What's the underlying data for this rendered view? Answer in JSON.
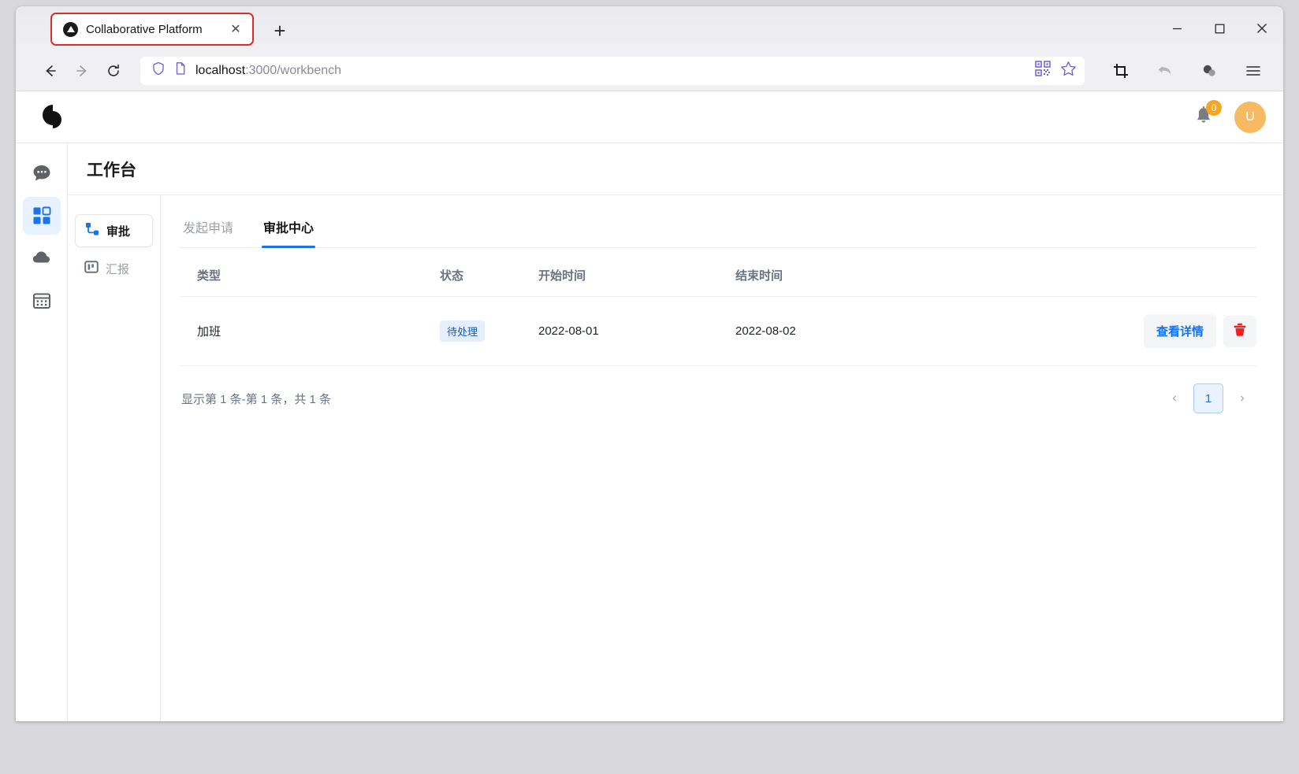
{
  "browser": {
    "tab": {
      "title": "Collaborative Platform",
      "favicon": "triangle-favicon",
      "close_label": "✕"
    },
    "new_tab_label": "+",
    "window_controls": {
      "minimize": "—",
      "maximize": "▢",
      "close": "✕"
    },
    "nav": {
      "back": "←",
      "forward": "→",
      "reload": "⟳"
    },
    "url": {
      "host": "localhost",
      "rest": ":3000/workbench"
    },
    "urlbar_icons": [
      "shield-icon",
      "page-icon",
      "qr-code-icon",
      "bookmark-star-icon"
    ],
    "toolbar_icons": [
      "crop-icon",
      "undo-icon",
      "extension-icon",
      "menu-icon"
    ]
  },
  "app": {
    "logo_name": "collaborative-platform-logo",
    "notifications": {
      "icon": "bell-icon",
      "count": "0"
    },
    "avatar": {
      "initial": "U"
    },
    "rail": [
      {
        "name": "sidebar-item-chat",
        "icon": "chat-bubble-icon",
        "active": false
      },
      {
        "name": "sidebar-item-workbench",
        "icon": "apps-grid-icon",
        "active": true
      },
      {
        "name": "sidebar-item-cloud",
        "icon": "cloud-icon",
        "active": false
      },
      {
        "name": "sidebar-item-calendar",
        "icon": "calendar-grid-icon",
        "active": false
      }
    ],
    "page_title": "工作台",
    "submenu": [
      {
        "label": "审批",
        "icon": "approval-icon",
        "active": true
      },
      {
        "label": "汇报",
        "icon": "report-icon",
        "active": false
      }
    ],
    "tabs": [
      {
        "label": "发起申请",
        "active": false
      },
      {
        "label": "审批中心",
        "active": true
      }
    ],
    "table": {
      "columns": [
        "类型",
        "状态",
        "开始时间",
        "结束时间",
        ""
      ],
      "rows": [
        {
          "type": "加班",
          "status": "待处理",
          "start_time": "2022-08-01",
          "end_time": "2022-08-02",
          "detail_label": "查看详情",
          "delete_icon": "trash-icon"
        }
      ]
    },
    "footer": {
      "summary": "显示第 1 条-第 1 条，共 1 条",
      "prev_label": "‹",
      "next_label": "›",
      "current_page": "1"
    },
    "colors": {
      "accent": "#1a73e8",
      "badge_bg": "#e4eefc",
      "badge_text": "#1558c0",
      "avatar_bg": "#f8b963",
      "notification_badge": "#f5a623",
      "delete_red": "#ee2222"
    }
  }
}
